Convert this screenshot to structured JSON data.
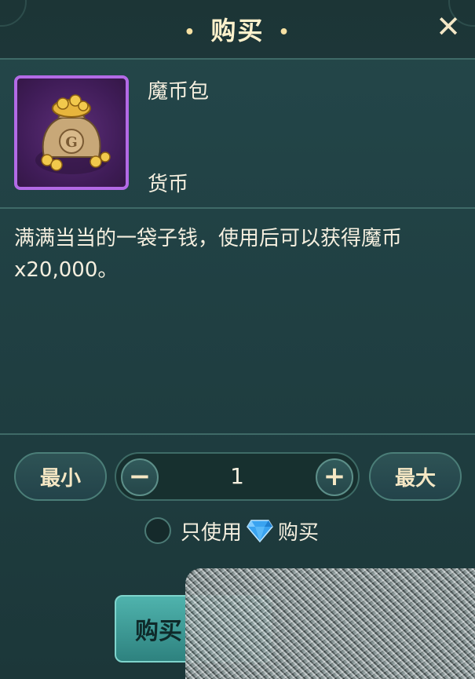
{
  "dialog": {
    "title": "购买",
    "close_icon": "close-icon"
  },
  "item": {
    "name": "魔币包",
    "type": "货币",
    "icon": "coin-bag-icon",
    "rarity_color": "#b36ae6",
    "description": "满满当当的一袋子钱，使用后可以获得魔币x20,000。"
  },
  "quantity": {
    "min_label": "最小",
    "max_label": "最大",
    "value": "1",
    "decrease_icon": "minus-icon",
    "increase_icon": "plus-icon"
  },
  "currency_option": {
    "prefix": "只使用",
    "gem_icon": "diamond-icon",
    "suffix": "购买",
    "checked": false
  },
  "actions": {
    "buy_label": "购买"
  },
  "colors": {
    "accent": "#4fb3ad",
    "panel": "#24474a",
    "text": "#f5efdf"
  }
}
